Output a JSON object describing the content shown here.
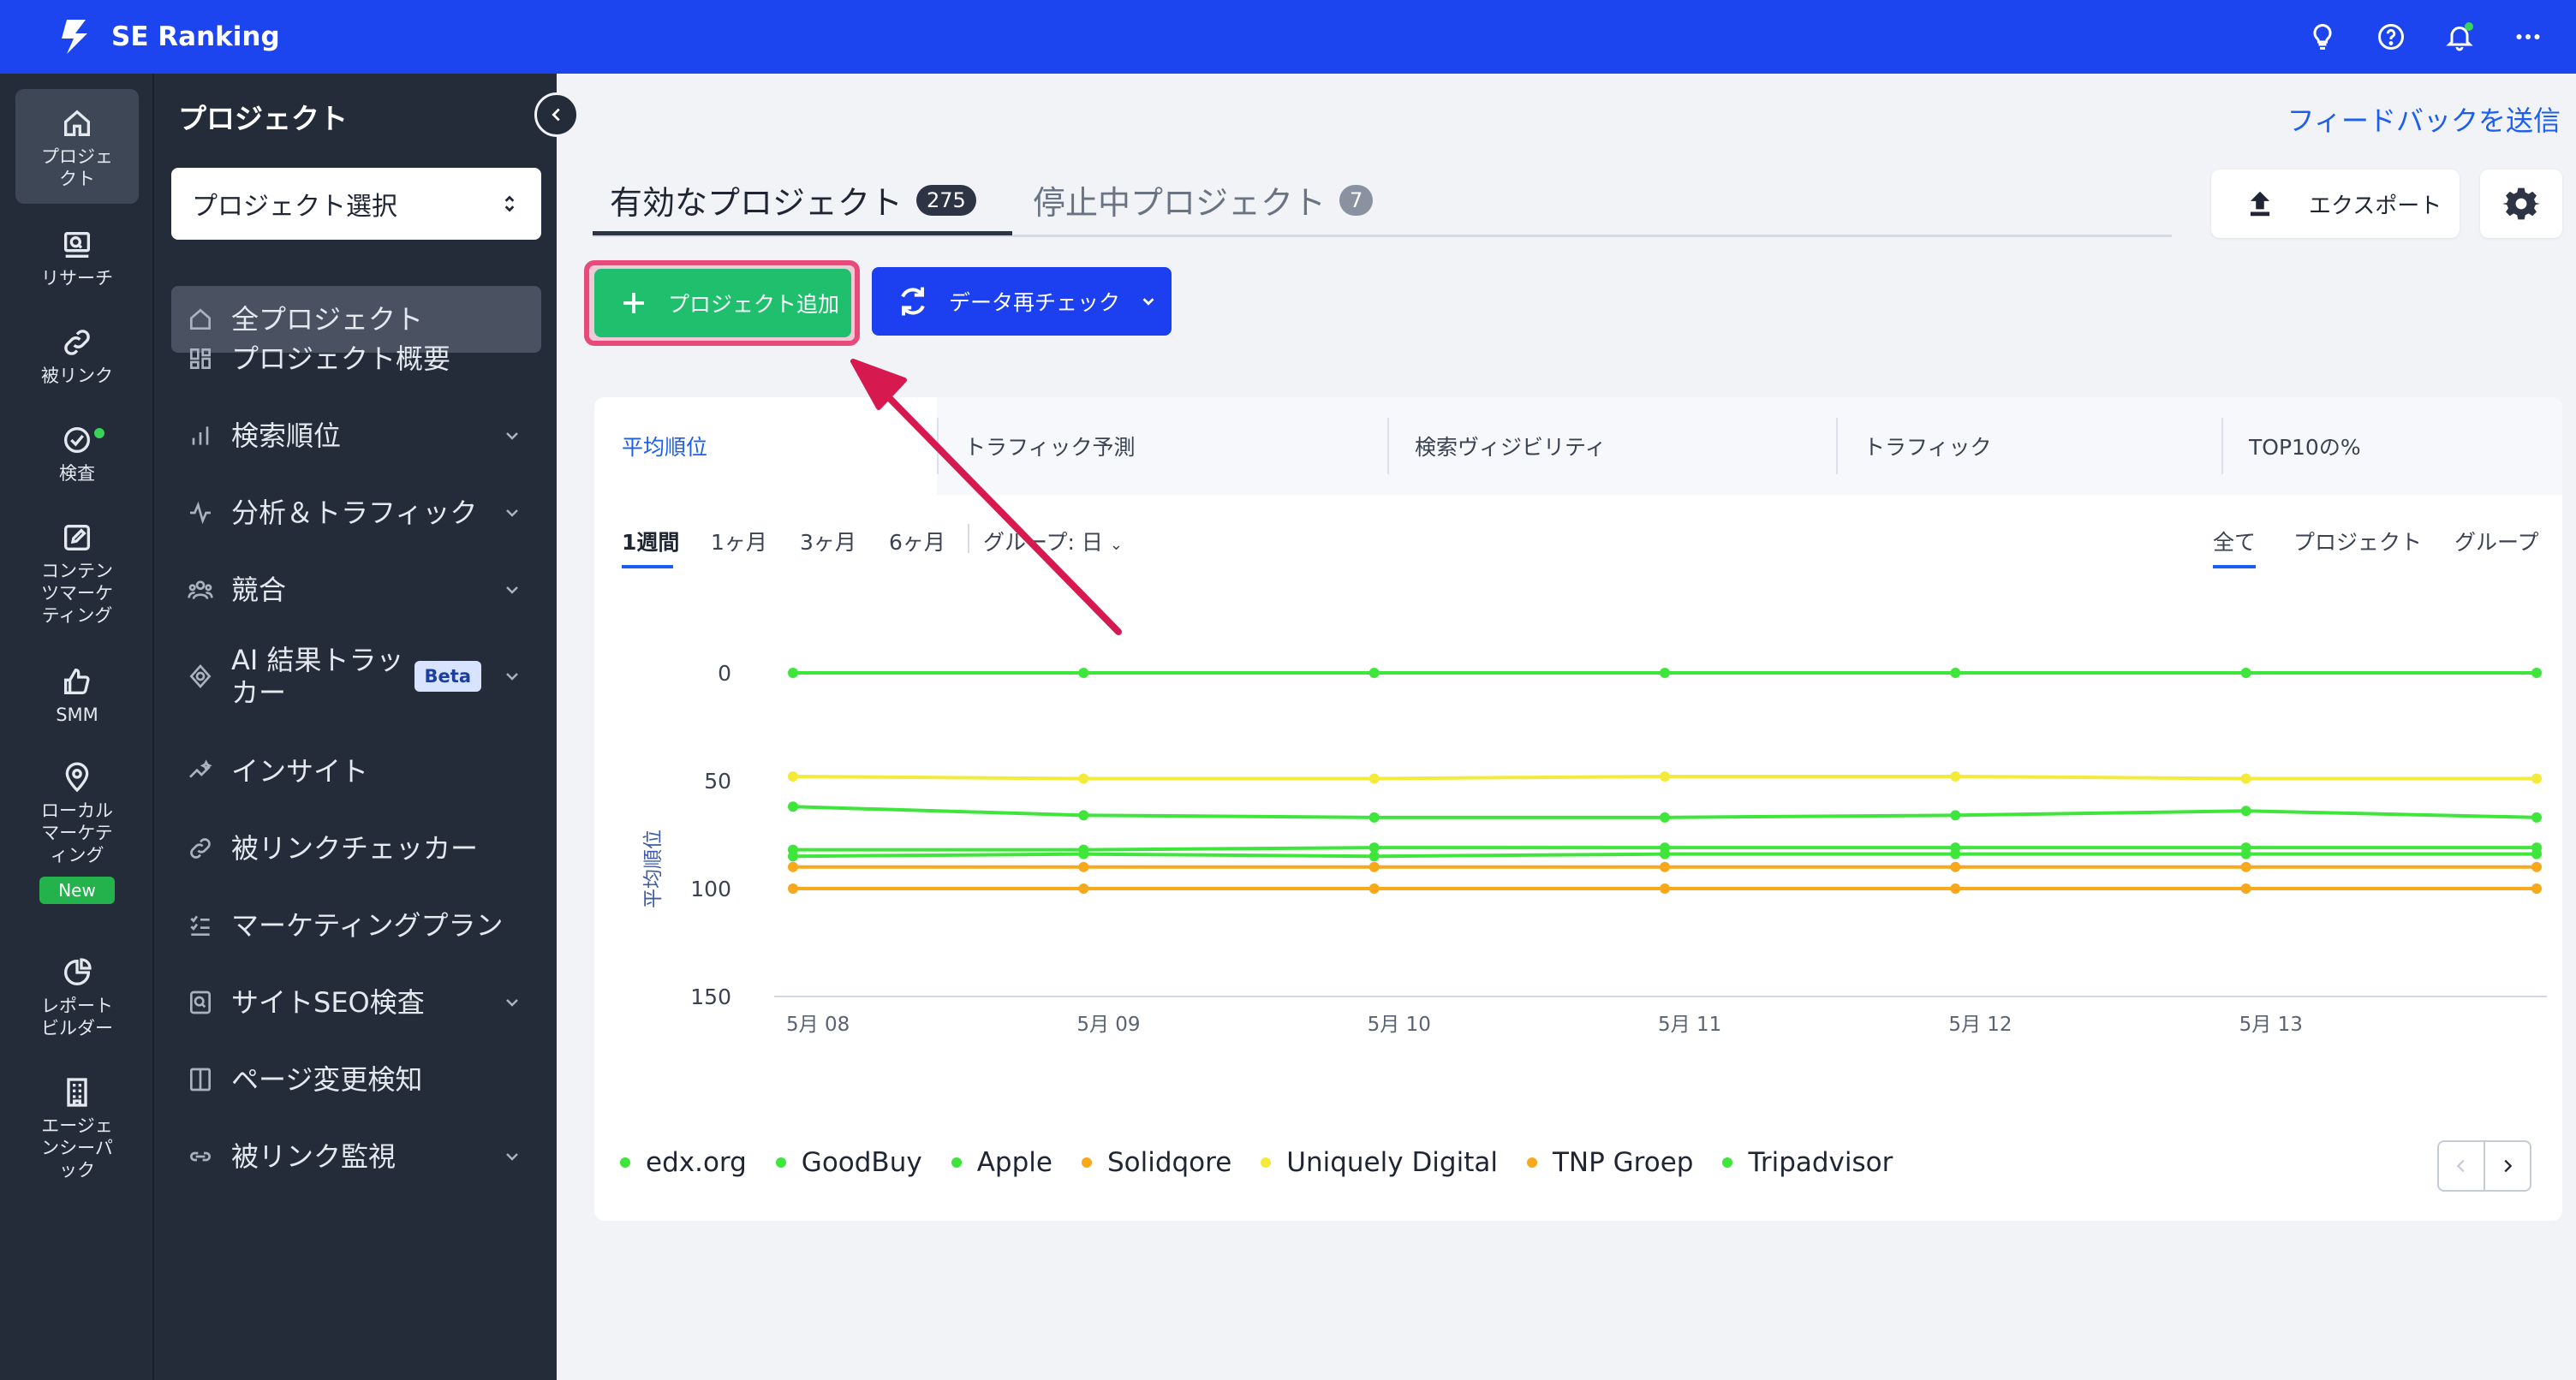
{
  "app": {
    "brand": "SE Ranking"
  },
  "rail": [
    {
      "label": "プロジェクト",
      "icon": "home-icon"
    },
    {
      "label": "リサーチ",
      "icon": "research-icon"
    },
    {
      "label": "被リンク",
      "icon": "link-icon"
    },
    {
      "label": "検査",
      "icon": "check-circle-icon"
    },
    {
      "label": "コンテンツマーケティング",
      "icon": "edit-icon"
    },
    {
      "label": "SMM",
      "icon": "thumbs-up-icon"
    },
    {
      "label": "ローカルマーケティング",
      "icon": "location-pin-icon",
      "badge": "New"
    },
    {
      "label": "レポートビルダー",
      "icon": "pie-chart-icon"
    },
    {
      "label": "エージェンシーパック",
      "icon": "building-icon"
    }
  ],
  "sidenav": {
    "title": "プロジェクト",
    "select_label": "プロジェクト選択",
    "items": [
      {
        "label": "全プロジェクト",
        "icon": "home-icon"
      },
      {
        "label": "プロジェクト概要",
        "icon": "grid-icon"
      },
      {
        "label": "検索順位",
        "icon": "bar-chart-icon"
      },
      {
        "label": "分析＆トラフィック",
        "icon": "pulse-icon"
      },
      {
        "label": "競合",
        "icon": "users-icon"
      },
      {
        "label": "AI 結果トラッカー",
        "icon": "ai-tracker-icon",
        "badge": "Beta"
      },
      {
        "label": "インサイト",
        "icon": "sparkle-trend-icon"
      },
      {
        "label": "被リンクチェッカー",
        "icon": "link-icon"
      },
      {
        "label": "マーケティングプラン",
        "icon": "checklist-icon"
      },
      {
        "label": "サイトSEO検査",
        "icon": "search-doc-icon"
      },
      {
        "label": "ページ変更検知",
        "icon": "page-compare-icon"
      },
      {
        "label": "被リンク監視",
        "icon": "link-icon"
      }
    ]
  },
  "main": {
    "feedback": "フィードバックを送信",
    "tabs": [
      {
        "label": "有効なプロジェクト",
        "count": "275"
      },
      {
        "label": "停止中プロジェクト",
        "count": "7"
      }
    ],
    "export_label": "エクスポート",
    "add_project_label": "プロジェクト追加",
    "recheck_label": "データ再チェック",
    "metric_tabs": [
      "平均順位",
      "トラフィック予測",
      "検索ヴィジビリティ",
      "トラフィック",
      "TOP10の%"
    ],
    "range_tabs": [
      "1週間",
      "1ヶ月",
      "3ヶ月",
      "6ヶ月"
    ],
    "group_label": "グループ: 日",
    "filter_tabs": [
      "全て",
      "プロジェクト",
      "グループ"
    ]
  },
  "colors": {
    "edx": "#3ee53a",
    "goodbuy": "#3ee53a",
    "apple": "#3ee53a",
    "solidqore": "#f7a81b",
    "uniquely": "#f3ea3a",
    "tnp": "#f7a81b",
    "tripadvisor": "#3ee53a"
  },
  "chart_data": {
    "type": "line",
    "x": [
      "5月 08",
      "5月 09",
      "5月 10",
      "5月 11",
      "5月 12",
      "5月 13",
      ""
    ],
    "ylabel": "平均順位",
    "yticks": [
      "0",
      "50",
      "100",
      "150"
    ],
    "ylim": [
      0,
      150
    ],
    "inverted": true,
    "series": [
      {
        "name": "edx.org",
        "color": "#3ee53a",
        "values": [
          0,
          0,
          0,
          0,
          0,
          0,
          0
        ]
      },
      {
        "name": "GoodBuy",
        "color": "#3ee53a",
        "values": [
          62,
          66,
          67,
          67,
          66,
          64,
          67
        ]
      },
      {
        "name": "Apple",
        "color": "#3ee53a",
        "values": [
          82,
          82,
          81,
          81,
          81,
          81,
          81
        ]
      },
      {
        "name": "Solidqore",
        "color": "#f7a81b",
        "values": [
          100,
          100,
          100,
          100,
          100,
          100,
          100
        ]
      },
      {
        "name": "Uniquely Digital",
        "color": "#f3ea3a",
        "values": [
          48,
          49,
          49,
          48,
          48,
          49,
          49
        ]
      },
      {
        "name": "TNP Groep",
        "color": "#f7a81b",
        "values": [
          90,
          90,
          90,
          90,
          90,
          90,
          90
        ]
      },
      {
        "name": "Tripadvisor",
        "color": "#3ee53a",
        "values": [
          85,
          84,
          85,
          84,
          84,
          84,
          84
        ]
      }
    ],
    "legend_position": "bottom-left"
  }
}
